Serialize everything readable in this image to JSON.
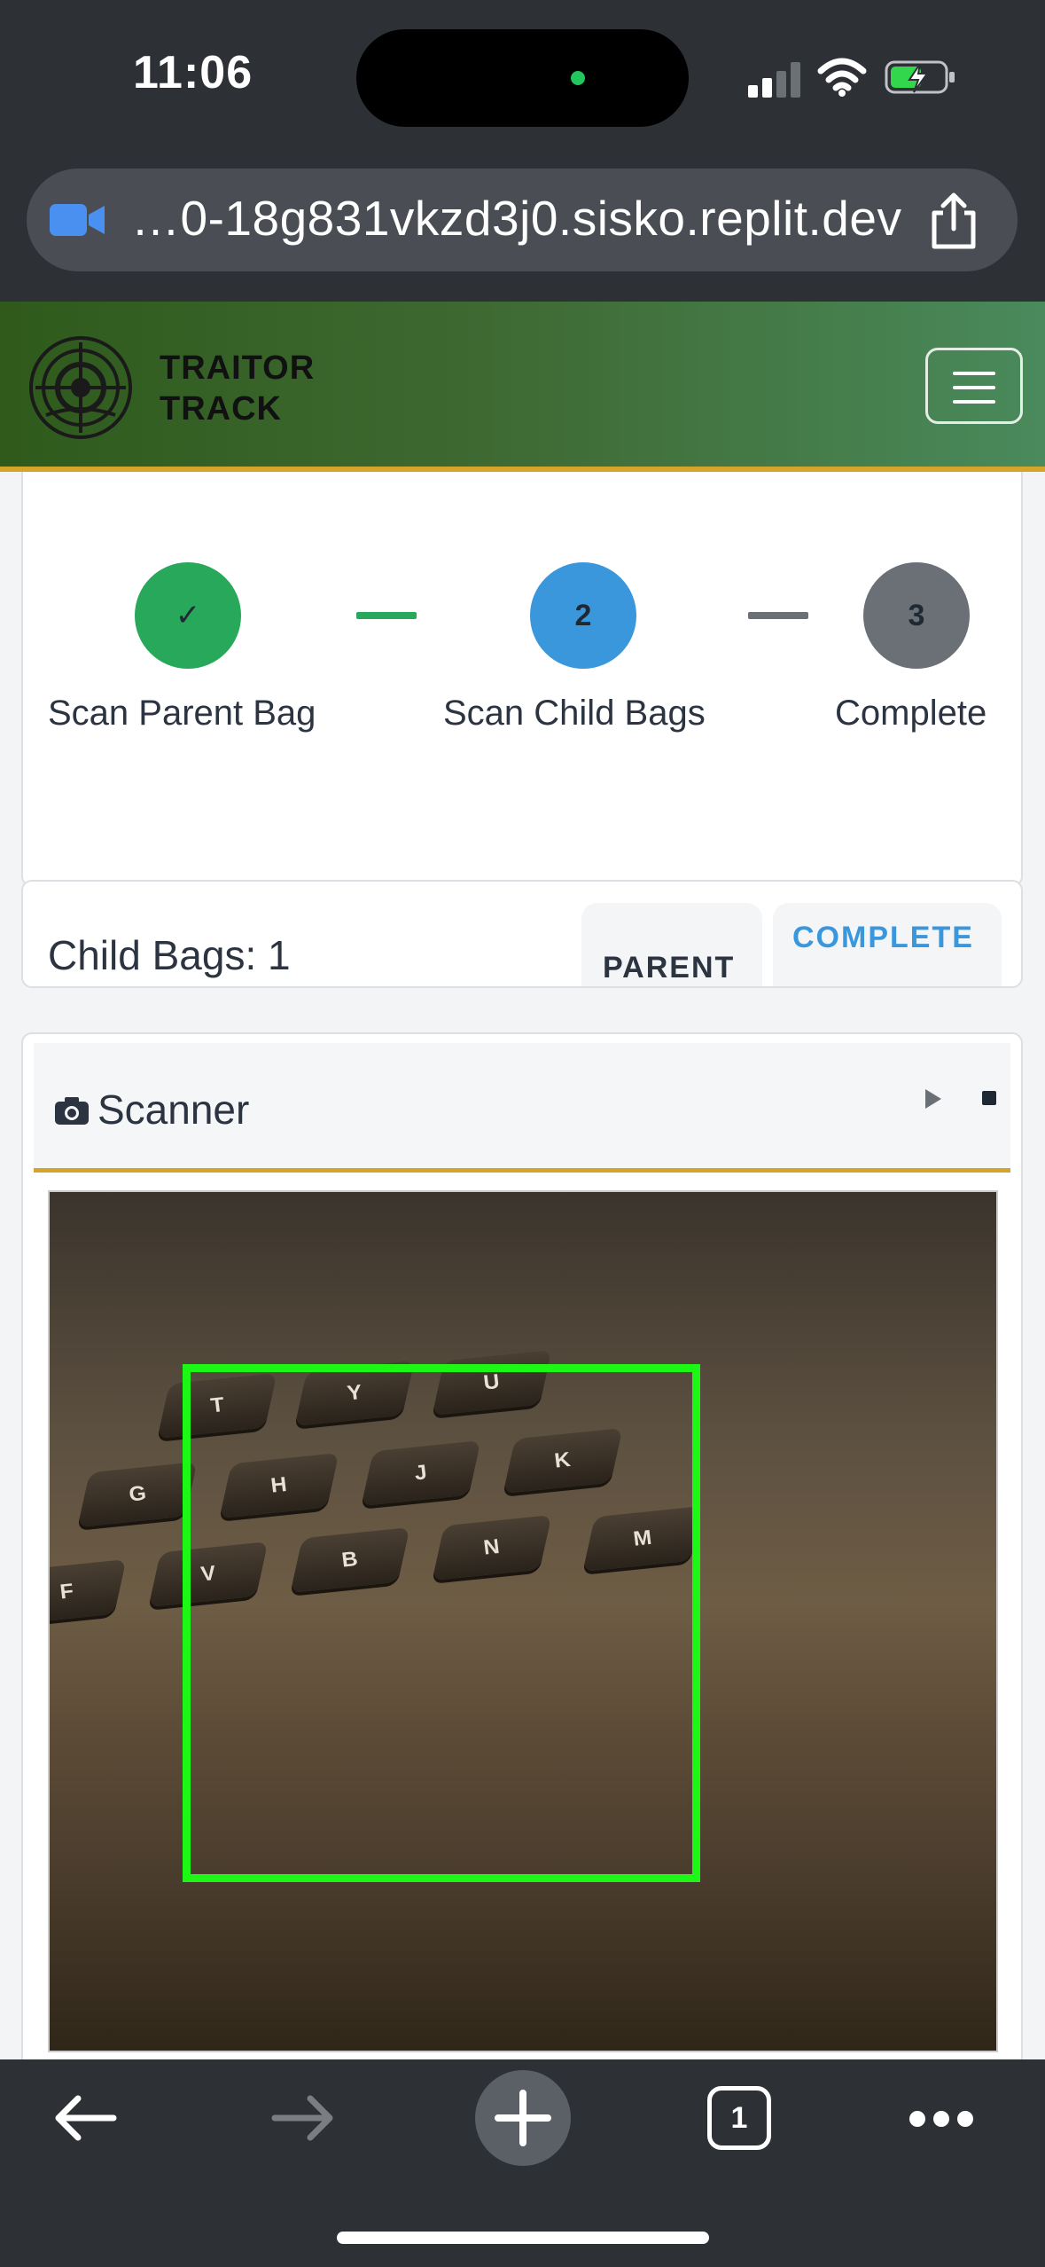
{
  "status_bar": {
    "time": "11:06"
  },
  "browser": {
    "url": "…0-18g831vkzd3j0.sisko.replit.dev",
    "open_tabs": "1"
  },
  "navbar": {
    "brand_line1": "TRAITOR",
    "brand_line2": "TRACK"
  },
  "steps": [
    {
      "marker": "✓",
      "label": "Scan Parent Bag",
      "state": "done",
      "color": "#27a85a"
    },
    {
      "marker": "2",
      "label": "Scan Child Bags",
      "state": "active",
      "color": "#3a97dc"
    },
    {
      "marker": "3",
      "label": "Complete",
      "state": "pending",
      "color": "#6b7077"
    }
  ],
  "connectors": [
    {
      "color": "#27a85a"
    },
    {
      "color": "#6b7077"
    }
  ],
  "counter": {
    "text": "Child Bags: 1",
    "tabs": [
      {
        "label": "PARENT",
        "color": "#2b3440"
      },
      {
        "label": "COMPLETE",
        "color": "#3a97dc"
      }
    ]
  },
  "scanner": {
    "title": "Scanner"
  },
  "camera_keys": [
    "T",
    "Y",
    "U",
    "G",
    "H",
    "J",
    "K",
    "F",
    "V",
    "B",
    "N",
    "M"
  ],
  "colors": {
    "accent_gold": "#d4a528",
    "scan_frame": "#1df716",
    "navbar_start": "#2f5a1c",
    "navbar_end": "#4a8a5c"
  }
}
